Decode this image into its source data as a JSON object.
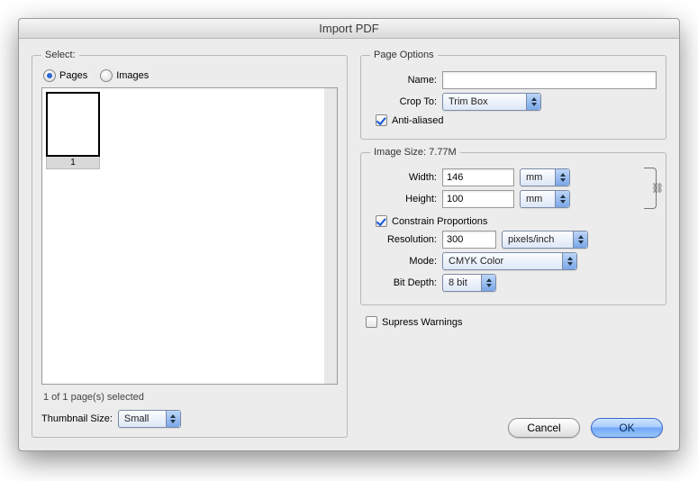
{
  "title": "Import PDF",
  "select": {
    "legend": "Select:",
    "pages_label": "Pages",
    "images_label": "Images",
    "selected": "pages",
    "thumb_caption": "1",
    "status": "1 of 1 page(s) selected",
    "thumb_size_label": "Thumbnail Size:",
    "thumb_size_value": "Small"
  },
  "page_options": {
    "legend": "Page Options",
    "name_label": "Name:",
    "name_value": "",
    "crop_label": "Crop To:",
    "crop_value": "Trim Box",
    "antialiased_label": "Anti-aliased",
    "antialiased_checked": true
  },
  "image_size": {
    "legend": "Image Size: 7.77M",
    "width_label": "Width:",
    "width_value": "146",
    "width_unit": "mm",
    "height_label": "Height:",
    "height_value": "100",
    "height_unit": "mm",
    "constrain_label": "Constrain Proportions",
    "constrain_checked": true,
    "resolution_label": "Resolution:",
    "resolution_value": "300",
    "resolution_unit": "pixels/inch",
    "mode_label": "Mode:",
    "mode_value": "CMYK Color",
    "bitdepth_label": "Bit Depth:",
    "bitdepth_value": "8 bit"
  },
  "suppress": {
    "label": "Supress Warnings",
    "checked": false
  },
  "buttons": {
    "cancel": "Cancel",
    "ok": "OK"
  }
}
